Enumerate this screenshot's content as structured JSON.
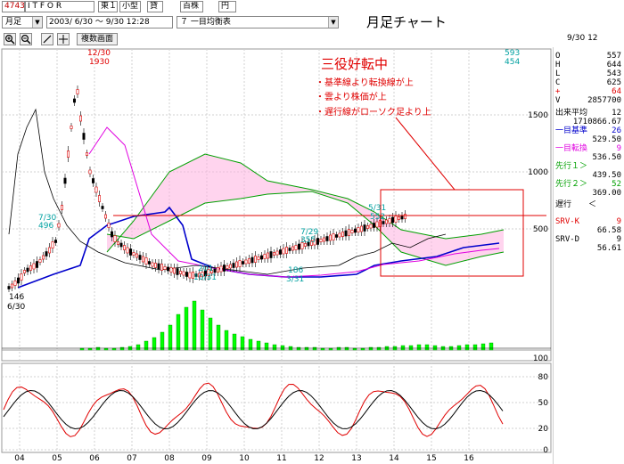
{
  "toolbar": {
    "code": "4743",
    "name": "I T F O R",
    "market": "東１",
    "size": "小型",
    "type": "貸",
    "unit": "百株",
    "currency": "円",
    "period": "月足",
    "date_range": "2003/ 6/30 〜  9/30 12:28",
    "indicator": "７ 一目均衡表",
    "multi_chart_label": "複数画面",
    "page_title": "月足チャート"
  },
  "info": {
    "date": "9/30 12",
    "o_label": "O",
    "o_value": "557",
    "h_label": "H",
    "h_value": "644",
    "l_label": "L",
    "l_value": "543",
    "c_label": "C",
    "c_value": "625",
    "plus_label": "+",
    "plus_value": "64",
    "v_label": "V",
    "v_value": "2857700",
    "vol_avg_label": "出来平均",
    "vol_avg_period": "12",
    "vol_avg_value": "1710866.67",
    "kijun_label": "一目基準",
    "kijun_period": "26",
    "kijun_value": "529.50",
    "tenkan_label": "一目転換",
    "tenkan_period": "9",
    "tenkan_value": "536.50",
    "senko1_label": "先行１＞",
    "senko1_value": "439.50",
    "senko2_label": "先行２＞",
    "senko2_period": "52",
    "senko2_value": "369.00",
    "chikou_label": "遅行",
    "chikou_mark": "＜",
    "srvk_label": "SRV-K",
    "srvk_period": "9",
    "srvk_value": "66.58",
    "srvd_label": "SRV-D",
    "srvd_period": "9",
    "srvd_value": "56.61"
  },
  "annotation": {
    "title": "三役好転中",
    "line1": "・基準線より転換線が上",
    "line2": "・雲より株価が上",
    "line3": "・遅行線がローソク足より上"
  },
  "labels": {
    "peak_date": "12/30",
    "peak_value": "1930",
    "low1_date": "6/30",
    "low1_value": "146",
    "a_date": "7/30",
    "a_value": "496",
    "b_value": "201",
    "b_date": "10/31",
    "c_value": "186",
    "c_date": "3/31",
    "d_date": "7/29",
    "d_value": "355",
    "e_date": "5/31",
    "e_value": "552",
    "f_value": "593",
    "g_value": "454"
  },
  "chart_data": {
    "type": "line",
    "price_axis_ticks": [
      "1500",
      "1000",
      "500"
    ],
    "volume_axis_ticks": [
      "100"
    ],
    "oscillator_axis_ticks": [
      "80",
      "50",
      "20",
      "0"
    ],
    "x_tick_labels": [
      "04",
      "05",
      "06",
      "07",
      "08",
      "09",
      "10",
      "11",
      "12",
      "13",
      "14",
      "15",
      "16"
    ],
    "series": [
      {
        "name": "一目基準",
        "values": []
      },
      {
        "name": "一目転換",
        "values": []
      },
      {
        "name": "SRV-K",
        "values": []
      },
      {
        "name": "SRV-D",
        "values": []
      }
    ],
    "colors": {
      "candle": "#000000",
      "kijun": "#0000cc",
      "tenkan": "#e000e0",
      "senko": "#00a000",
      "chikou": "#000000",
      "cloud": "#ffb0e0",
      "volume": "#00ff00",
      "srvk": "#e00000",
      "srvd": "#000000",
      "annotation": "#e00000"
    }
  }
}
